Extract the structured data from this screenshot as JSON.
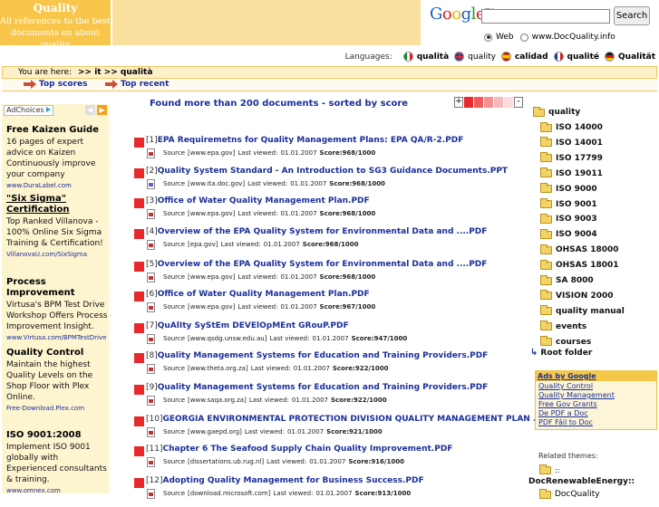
{
  "header": {
    "logo_title": "Quality",
    "logo_tagline": "All references to the best documents on about quality"
  },
  "search": {
    "google_label": "Google",
    "google_tm": "TM",
    "button": "Search",
    "options": [
      "Web",
      "www.DocQuality.info"
    ]
  },
  "languages": {
    "label": "Languages:",
    "items": [
      {
        "label": "qualità",
        "flag": "it",
        "bold": true
      },
      {
        "label": "quality",
        "flag": "uk",
        "bold": false
      },
      {
        "label": "calidad",
        "flag": "es",
        "bold": true
      },
      {
        "label": "qualité",
        "flag": "fr",
        "bold": true
      },
      {
        "label": "Qualität",
        "flag": "de",
        "bold": true
      }
    ]
  },
  "breadcrumb": {
    "prefix": "You are here:",
    "path": ">> it >> qualità"
  },
  "toolbar": {
    "top_scores": "Top scores",
    "top_recent": "Top recent"
  },
  "ads_left": {
    "adchoices": "AdChoices",
    "items": [
      {
        "title": "Free Kaizen Guide",
        "body": "16 pages of expert advice on Kaizen Continuously improve your company",
        "url": "www.DuraLabel.com",
        "underline": false
      },
      {
        "title": "\"Six Sigma\" Certification",
        "body": "Top Ranked Villanova - 100% Online Six Sigma Training & Certification!",
        "url": "VillanovaU.com/SixSigma",
        "underline": true
      },
      {
        "title": "Process Improvement",
        "body": "Virtusa's BPM Test Drive Workshop Offers Process Improvement Insight.",
        "url": "www.Virtusa.com/BPMTestDrive",
        "underline": false
      },
      {
        "title": "Quality Control",
        "body": "Maintain the highest Quality Levels on the Shop Floor with Plex Online.",
        "url": "Free-Download.Plex.com",
        "underline": false
      },
      {
        "title": "ISO 9001:2008",
        "body": "Implement ISO 9001 globally with Experienced consultants & training.",
        "url": "www.omnex.com",
        "underline": false
      }
    ]
  },
  "results": {
    "summary": "Found more than 200 documents - sorted by score",
    "legend_colors": [
      "#e8282a",
      "#ee5a5c",
      "#f29092",
      "#f6b8ba",
      "#fadcdd"
    ],
    "labels": {
      "source": "Source",
      "last_viewed": "Last viewed:",
      "score": "Score:"
    },
    "items": [
      {
        "num": "[1]",
        "title": "EPA Requiremetns for Quality Management Plans: EPA QA/R-2.PDF",
        "source": "[www.epa.gov]",
        "viewed": "01.01.2007",
        "score": "968/1000",
        "type": "pdf"
      },
      {
        "num": "[2]",
        "title": "Quality System Standard - An Introduction to SG3 Guidance Documents.PPT",
        "source": "[www.ita.doc.gov]",
        "viewed": "01.01.2007",
        "score": "968/1000",
        "type": "ppt"
      },
      {
        "num": "[3]",
        "title": "Office of Water Quality Management Plan.PDF",
        "source": "[www.epa.gov]",
        "viewed": "01.01.2007",
        "score": "968/1000",
        "type": "pdf"
      },
      {
        "num": "[4]",
        "title": "Overview of the EPA Quality System for Environmental Data and ....PDF",
        "source": "[epa.gov]",
        "viewed": "01.01.2007",
        "score": "968/1000",
        "type": "pdf"
      },
      {
        "num": "[5]",
        "title": "Overview of the EPA Quality System for Environmental Data and ....PDF",
        "source": "[www.epa.gov]",
        "viewed": "01.01.2007",
        "score": "968/1000",
        "type": "pdf"
      },
      {
        "num": "[6]",
        "title": "Office of Water Quality Management Plan.PDF",
        "source": "[www.epa.gov]",
        "viewed": "01.01.2007",
        "score": "967/1000",
        "type": "pdf"
      },
      {
        "num": "[7]",
        "title": "QuAlIty SyStEm DEVElOpMEnt GRouP.PDF",
        "source": "[www.qsdg.unsw.edu.au]",
        "viewed": "01.01.2007",
        "score": "947/1000",
        "type": "pdf"
      },
      {
        "num": "[8]",
        "title": "Quality Management Systems for Education and Training Providers.PDF",
        "source": "[www.theta.org.za]",
        "viewed": "01.01.2007",
        "score": "922/1000",
        "type": "pdf"
      },
      {
        "num": "[9]",
        "title": "Quality Management Systems for Education and Training Providers.PDF",
        "source": "[www.saqa.org.za]",
        "viewed": "01.01.2007",
        "score": "922/1000",
        "type": "pdf"
      },
      {
        "num": "[10]",
        "title": "GEORGIA ENVIRONMENTAL PROTECTION DIVISION QUALITY MANAGEMENT PLAN ....PDF",
        "source": "[www.gaepd.org]",
        "viewed": "01.01.2007",
        "score": "921/1000",
        "type": "pdf"
      },
      {
        "num": "[11]",
        "title": "Chapter 6 The Seafood Supply Chain Quality Improvement.PDF",
        "source": "[dissertations.ub.rug.nl]",
        "viewed": "01.01.2007",
        "score": "916/1000",
        "type": "pdf"
      },
      {
        "num": "[12]",
        "title": "Adopting Quality Management for Business Success.PDF",
        "source": "[download.microsoft.com]",
        "viewed": "01.01.2007",
        "score": "913/1000",
        "type": "pdf"
      }
    ]
  },
  "sidebar": {
    "root": "quality",
    "items": [
      "ISO 14000",
      "ISO 14001",
      "ISO 17799",
      "ISO 19011",
      "ISO 9000",
      "ISO 9001",
      "ISO 9003",
      "ISO 9004",
      "OHSAS 18000",
      "OHSAS 18001",
      "SA 8000",
      "VISION 2000",
      "quality manual",
      "events",
      "courses"
    ],
    "root_folder": "Root folder",
    "ads_title": "Ads by Google",
    "ads": [
      "Quality Control",
      "Quality Management",
      "Free Gov Grants",
      "De PDF a Doc",
      "PDF Fáil to Doc"
    ],
    "related_label": "Related themes:",
    "related_sep": "::",
    "related_item": "DocRenewableEnergy::",
    "related_more": "DocQuality"
  }
}
